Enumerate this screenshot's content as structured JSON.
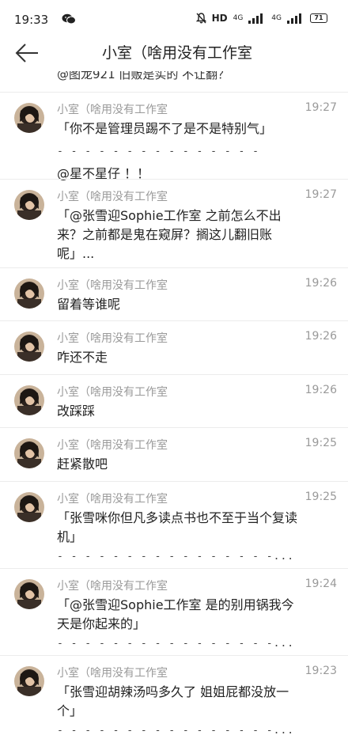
{
  "status_bar": {
    "time": "19:33",
    "network": "HD",
    "signal_1": "4G",
    "signal_2": "4G",
    "battery": "71"
  },
  "header": {
    "title": "小室（啥用没有工作室"
  },
  "partial_message": "@图龙921 旧贩是实的 不让翻？",
  "messages": [
    {
      "name": "小室（啥用没有工作室",
      "time": "19:27",
      "text": "「你不是管理员踢不了是不是特别气」",
      "dashes": "- - - - - - - - - - - - - - -",
      "after": "@星不星仔 ！！"
    },
    {
      "name": "小室（啥用没有工作室",
      "time": "19:27",
      "text": "「@张雪迎Sophie工作室 之前怎么不出来？之前都是鬼在窥屏？搁这儿翻旧账呢」..."
    },
    {
      "name": "小室（啥用没有工作室",
      "time": "19:26",
      "text": "留着等谁呢"
    },
    {
      "name": "小室（啥用没有工作室",
      "time": "19:26",
      "text": "咋还不走"
    },
    {
      "name": "小室（啥用没有工作室",
      "time": "19:26",
      "text": "改踩踩"
    },
    {
      "name": "小室（啥用没有工作室",
      "time": "19:25",
      "text": "赶紧散吧"
    },
    {
      "name": "小室（啥用没有工作室",
      "time": "19:25",
      "text": "「张雪咪你但凡多读点书也不至于当个复读机」",
      "dashes": "- - - - - - - - - - - - - - - -..."
    },
    {
      "name": "小室（啥用没有工作室",
      "time": "19:24",
      "text": "「@张雪迎Sophie工作室 是的别用锅我今天是你起来的」",
      "dashes": "- - - - - - - - - - - - - - - -..."
    },
    {
      "name": "小室（啥用没有工作室",
      "time": "19:23",
      "text": "「张雪迎胡辣汤吗多久了 姐姐屁都没放一个」",
      "dashes": "- - - - - - - - - - - - - - - -..."
    }
  ]
}
